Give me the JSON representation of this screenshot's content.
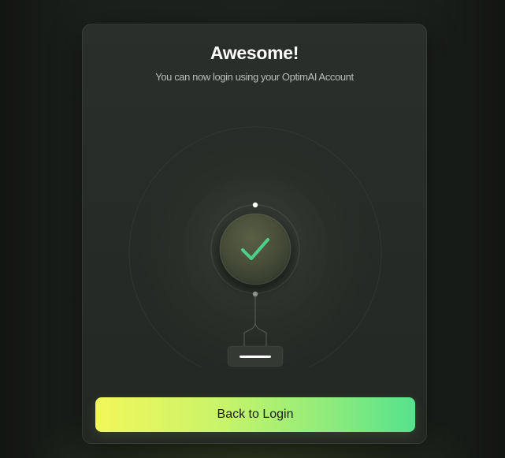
{
  "dialog": {
    "title": "Awesome!",
    "subtitle": "You can now login using your OptimAI Account",
    "button_label": "Back to Login"
  },
  "icons": {
    "status": "checkmark-icon",
    "indicator": "dash-indicator-icon"
  },
  "colors": {
    "accent_green": "#4ed08a",
    "button_gradient_start": "#f2f75a",
    "button_gradient_end": "#55e28d",
    "card_background": "#292d29",
    "page_background": "#1b1f1b"
  }
}
